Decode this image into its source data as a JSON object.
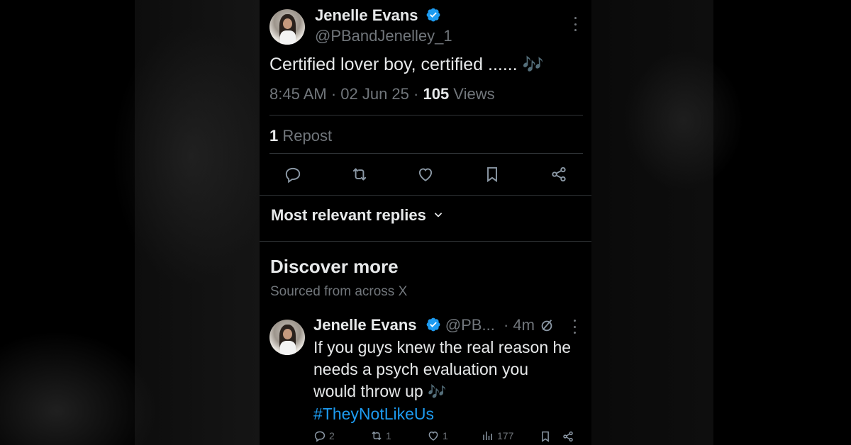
{
  "tweet": {
    "author_name": "Jenelle Evans",
    "author_handle": "@PBandJenelley_1",
    "text": "Certified lover boy, certified ......",
    "emoji": "🎶",
    "time": "8:45 AM · 02 Jun 25 · ",
    "views_count": "105",
    "views_label": " Views",
    "repost_count": "1",
    "repost_label": " Repost"
  },
  "replies_filter": {
    "label": "Most relevant replies"
  },
  "discover": {
    "title": "Discover more",
    "subtitle": "Sourced from across X"
  },
  "related_post": {
    "author_name": "Jenelle Evans",
    "author_handle": "@PB...",
    "time": "· 4m",
    "text_line1": "If you guys knew the real reason he",
    "text_line2": "needs a psych evaluation you",
    "text_line3": "would throw up",
    "emoji": "🎶",
    "hashtag": "#TheyNotLikeUs",
    "replies": "2",
    "reposts": "1",
    "likes": "1",
    "views": "177"
  },
  "icons": [
    "verified-badge-icon",
    "more-icon",
    "reply-icon",
    "repost-icon",
    "like-icon",
    "bookmark-icon",
    "share-icon",
    "chevron-down-icon",
    "grok-icon",
    "views-icon"
  ],
  "colors": {
    "background": "#000000",
    "text": "#e7e9ea",
    "muted": "#71767b",
    "accent": "#1d9bf0",
    "divider": "#2f3336"
  }
}
